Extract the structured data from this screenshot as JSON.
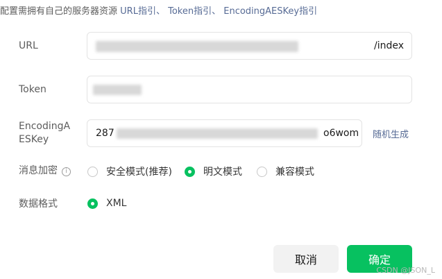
{
  "header": {
    "note": "配置需拥有自己的服务器资源",
    "links": [
      "URL指引、",
      "Token指引、",
      "EncodingAESKey指引"
    ]
  },
  "form": {
    "url": {
      "label": "URL",
      "value": "/index"
    },
    "token": {
      "label": "Token",
      "value": ""
    },
    "aes": {
      "label_line1": "EncodingA",
      "label_line2": "ESKey",
      "value_prefix": "287",
      "value_suffix": "o6wom",
      "random_link": "随机生成"
    },
    "encryption": {
      "label": "消息加密",
      "info_icon": "info-circle-icon",
      "options": [
        "安全模式(推荐)",
        "明文模式",
        "兼容模式"
      ],
      "selected": "明文模式"
    },
    "format": {
      "label": "数据格式",
      "options": [
        "XML"
      ],
      "selected": "XML"
    }
  },
  "actions": {
    "cancel": "取消",
    "confirm": "确定"
  },
  "watermark": "CSDN @JSON_L",
  "colors": {
    "accent": "#07c160",
    "link": "#576b95"
  }
}
